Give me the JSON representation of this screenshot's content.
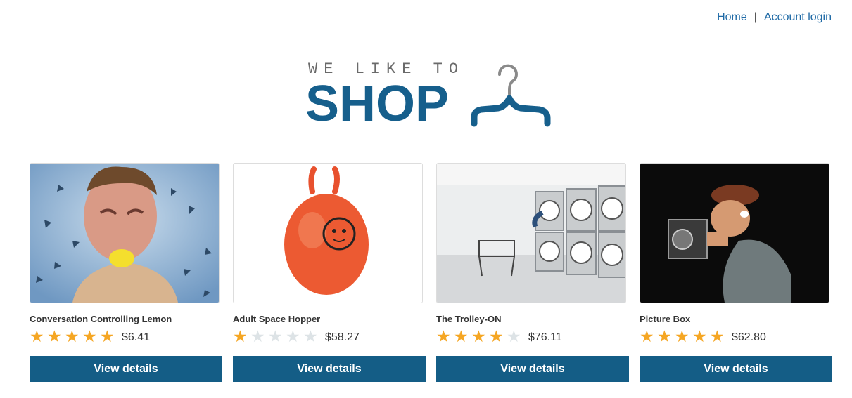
{
  "nav": {
    "home": "Home",
    "separator": "|",
    "account": "Account login"
  },
  "logo": {
    "tagline": "WE LIKE TO",
    "word": "SHOP"
  },
  "colors": {
    "brand": "#165f8c",
    "button": "#145d86",
    "link": "#1f6aa6",
    "star_on": "#f5a623",
    "star_off": "#dde3e6"
  },
  "products": [
    {
      "name": "Conversation Controlling Lemon",
      "rating": 5,
      "price": "$6.41",
      "button": "View details"
    },
    {
      "name": "Adult Space Hopper",
      "rating": 1,
      "price": "$58.27",
      "button": "View details"
    },
    {
      "name": "The Trolley-ON",
      "rating": 4,
      "price": "$76.11",
      "button": "View details"
    },
    {
      "name": "Picture Box",
      "rating": 5,
      "price": "$62.80",
      "button": "View details"
    }
  ]
}
